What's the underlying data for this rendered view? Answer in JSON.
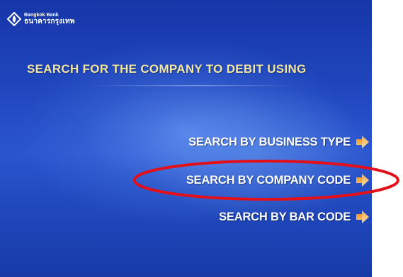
{
  "brand": {
    "name_en": "Bangkok Bank",
    "name_th": "ธนาคารกรุงเทพ",
    "logo_icon": "bangkok-bank-lotus-logo"
  },
  "screen": {
    "headline": "SEARCH FOR THE COMPANY TO DEBIT USING",
    "options": [
      {
        "label": "SEARCH BY BUSINESS TYPE",
        "icon": "arrow-right-icon"
      },
      {
        "label": "SEARCH BY COMPANY CODE",
        "icon": "arrow-right-icon"
      },
      {
        "label": "SEARCH BY BAR CODE",
        "icon": "arrow-right-icon"
      }
    ]
  },
  "colors": {
    "background_dark": "#1636a8",
    "background_light": "#2a55cf",
    "headline": "#f3e6a2",
    "option_text": "#ffffff",
    "arrow": "#f5a623",
    "highlight_ring": "#e3101a"
  }
}
